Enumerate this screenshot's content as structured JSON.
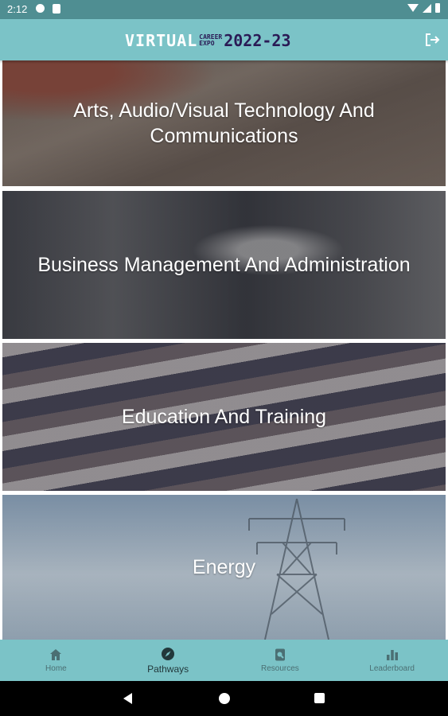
{
  "status_bar": {
    "time": "2:12"
  },
  "header": {
    "logo": {
      "virtual": "VIRTUAL",
      "career": "CAREER",
      "expo": "EXPO",
      "year": "2022-23"
    }
  },
  "pathways": [
    {
      "title": "Arts, Audio/Visual Technology And Communications"
    },
    {
      "title": "Business Management And Administration"
    },
    {
      "title": "Education And Training"
    },
    {
      "title": "Energy"
    }
  ],
  "bottom_nav": [
    {
      "label": "Home",
      "icon": "home-icon",
      "active": false
    },
    {
      "label": "Pathways",
      "icon": "compass-icon",
      "active": true
    },
    {
      "label": "Resources",
      "icon": "search-doc-icon",
      "active": false
    },
    {
      "label": "Leaderboard",
      "icon": "bar-chart-icon",
      "active": false
    }
  ],
  "colors": {
    "app_bar": "#7bc3c7",
    "status_bar": "#4f8e92",
    "logo_dark": "#2a1a55"
  }
}
